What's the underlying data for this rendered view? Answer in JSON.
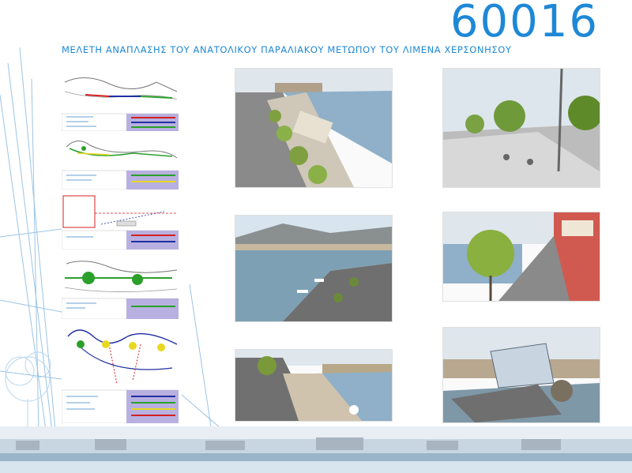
{
  "header": {
    "code": "60016",
    "title": "ΜΕΛΕΤΗ ΑΝΑΠΛΑΣΗΣ ΤΟΥ ΑΝΑΤΟΛΙΚΟΥ ΠΑΡΑΛΙΑΚΟΥ ΜΕΤΩΠΟΥ ΤΟΥ ΛΙΜΕΝΑ ΧΕΡΣΟΝΗΣΟΥ"
  },
  "colors": {
    "accent": "#1e88d6",
    "plan_red": "#d42020",
    "plan_blue": "#2030a0",
    "plan_green": "#2aa02a",
    "plan_yellow": "#e8d820",
    "legend_bg": "#b8b0e0",
    "sea": "#8fb0c8",
    "sky": "#d8e4ee"
  },
  "panels": {
    "plans": [
      {
        "name": "plan-1-overview"
      },
      {
        "name": "plan-2-routes"
      },
      {
        "name": "plan-3-section"
      },
      {
        "name": "plan-4-nodes"
      },
      {
        "name": "plan-5-network"
      }
    ],
    "renders": [
      {
        "name": "render-promenade-aerial"
      },
      {
        "name": "render-plaza-lamp"
      },
      {
        "name": "render-harbour-view"
      },
      {
        "name": "render-tree-street"
      },
      {
        "name": "render-seafront-deck"
      },
      {
        "name": "render-pavilion"
      }
    ]
  }
}
